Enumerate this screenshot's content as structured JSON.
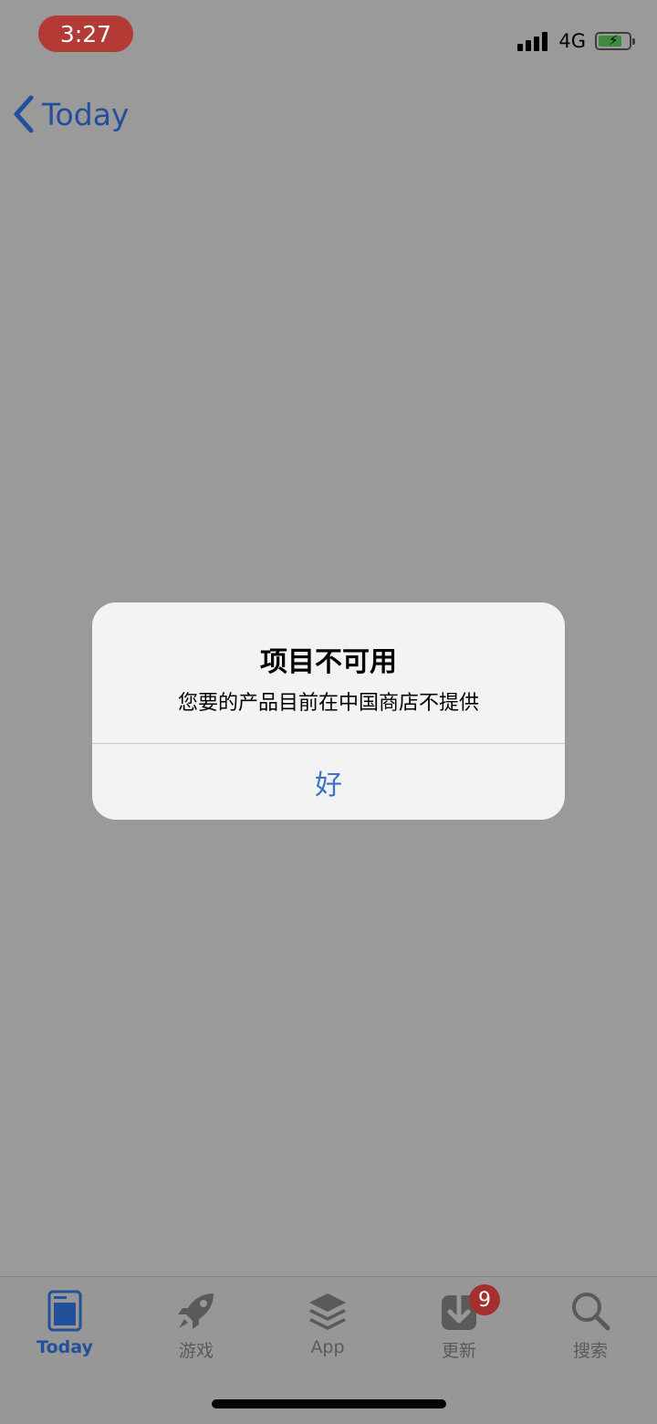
{
  "status_bar": {
    "time": "3:27",
    "network": "4G",
    "signal_bars": 4,
    "battery_icon": "battery-charging-icon",
    "colors": {
      "time_pill": "#b33a35",
      "battery_fill": "#3d8c3d"
    }
  },
  "nav": {
    "back_label": "Today",
    "back_icon": "chevron-left-icon",
    "color": "#23509b"
  },
  "alert": {
    "title": "项目不可用",
    "message": "您要的产品目前在中国商店不提供",
    "ok_label": "好",
    "button_color": "#3a72c4"
  },
  "tabbar": {
    "items": [
      {
        "label": "Today",
        "icon": "today-icon",
        "active": true
      },
      {
        "label": "游戏",
        "icon": "rocket-icon",
        "active": false
      },
      {
        "label": "App",
        "icon": "layers-icon",
        "active": false
      },
      {
        "label": "更新",
        "icon": "download-icon",
        "active": false,
        "badge": "9"
      },
      {
        "label": "搜索",
        "icon": "search-icon",
        "active": false
      }
    ],
    "active_color": "#23509b",
    "inactive_color": "#5a5a5a",
    "badge_color": "#a3302c"
  }
}
